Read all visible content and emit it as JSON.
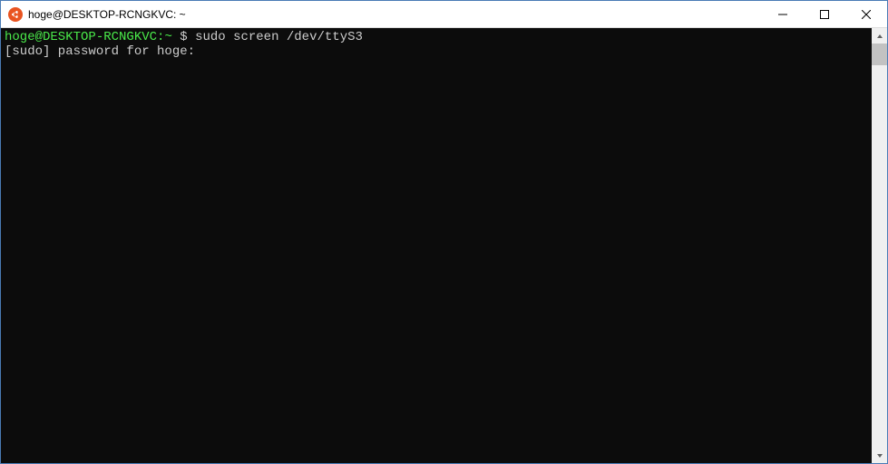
{
  "window": {
    "title": "hoge@DESKTOP-RCNGKVC: ~"
  },
  "terminal": {
    "prompt_host": "hoge@DESKTOP-RCNGKVC",
    "prompt_sep": ":",
    "prompt_path": "~",
    "prompt_symbol": "$",
    "command": "sudo screen /dev/ttyS3",
    "output_line": "[sudo] password for hoge:"
  }
}
